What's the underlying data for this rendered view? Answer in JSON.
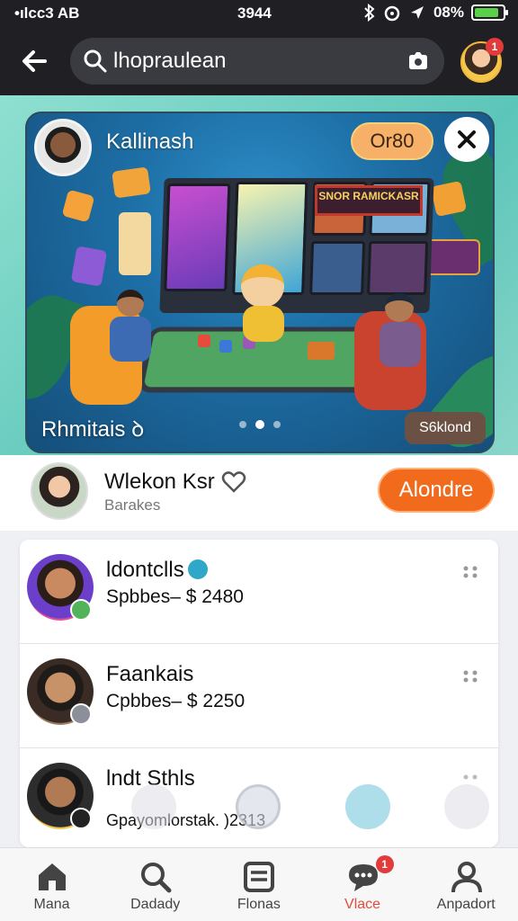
{
  "status_bar": {
    "carrier": "•ıl​cc3 AB",
    "time": "3944",
    "battery_text": "08%",
    "battery_level": 0.85,
    "icons": [
      "bluetooth-icon",
      "alarm-icon",
      "location-icon",
      "battery-icon"
    ]
  },
  "header": {
    "search_value": "lhopraulean",
    "icons": [
      "back-arrow-icon",
      "search-icon",
      "camera-icon"
    ],
    "avatar_badge": "1"
  },
  "banner": {
    "host_name": "Kallinash",
    "count_pill": "Or80",
    "caption": "Rhmitais ꝺ",
    "tag": "S6klond",
    "sign_text": "SNOR RAMICKASR",
    "page_count": 3,
    "active_page": 1,
    "colors": {
      "pill": "#f6b067",
      "tag": "#6b5144"
    }
  },
  "creator": {
    "name": "Wlekon Ksr",
    "subtitle": "Barakes",
    "button": "Alondre",
    "accent": "#f26a1b"
  },
  "list": {
    "items": [
      {
        "title": "ldontclls",
        "price": "Spbbes– $ 2480",
        "verified": true
      },
      {
        "title": "Faankais",
        "price": "Cpbbes– $ 2250",
        "verified": false
      },
      {
        "title": "lndt Sthls",
        "price": "Gpayomlorstak. )2313",
        "verified": false
      }
    ]
  },
  "bottom_nav": {
    "items": [
      {
        "label": "Mana",
        "icon": "home-icon"
      },
      {
        "label": "Dadady",
        "icon": "search-icon"
      },
      {
        "label": "Flonas",
        "icon": "list-icon"
      },
      {
        "label": "Vlace",
        "icon": "chat-icon",
        "badge": "1",
        "active": true
      },
      {
        "label": "Anpadort",
        "icon": "profile-icon"
      }
    ]
  }
}
